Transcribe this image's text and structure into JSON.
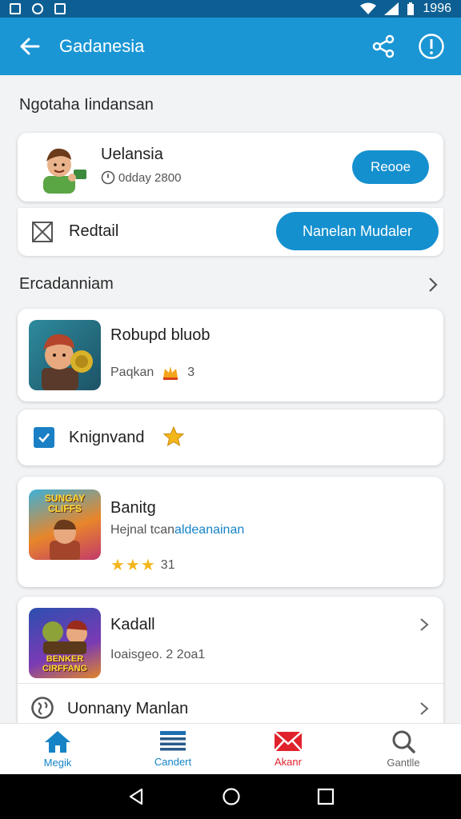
{
  "status_bar": {
    "time": "1996"
  },
  "app_bar": {
    "title": "Gadanesia"
  },
  "profile_section": {
    "title": "Ngotaha Iindansan"
  },
  "user_card": {
    "name": "Uelansia",
    "subtitle": "0dday 2800",
    "action_label": "Reooe"
  },
  "redtail_row": {
    "label": "Redtail",
    "action_label": "Nanelan Mudaler"
  },
  "list_section": {
    "title": "Ercadanniam"
  },
  "game_items": [
    {
      "title": "Robupd bluob",
      "sub_label": "Paqkan",
      "count": "3"
    },
    {
      "title": "Banitg",
      "sub_label": "Hejnal tcan",
      "sub_highlight": "aldeanainan",
      "rating_value": "31",
      "stars_count": 3,
      "thumb_text": "SUNGAY CLIFFS"
    },
    {
      "title": "Kadall",
      "sub_label": "Ioaisgeo. 2 2oa1",
      "thumb_text": "BENKER CIRFFANG"
    }
  ],
  "check_row": {
    "label": "Knignvand",
    "checked": true
  },
  "utility_row": {
    "label": "Uonnany Manlan"
  },
  "bottom_nav": [
    {
      "label": "Megik",
      "color": "#1583c6"
    },
    {
      "label": "Candert",
      "color": "#1583c6"
    },
    {
      "label": "Akanr",
      "color": "#e0222d"
    },
    {
      "label": "Gantlle",
      "color": "#666666"
    }
  ],
  "colors": {
    "primary": "#1a96d4",
    "status_bar": "#0d5f93",
    "accent_red": "#e0222d",
    "star": "#f3b61b"
  }
}
